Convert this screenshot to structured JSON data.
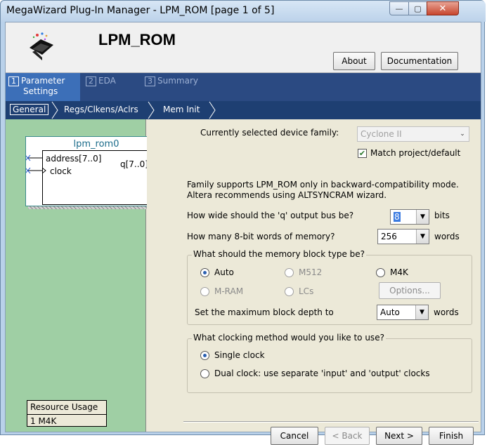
{
  "window": {
    "title": "MegaWizard Plug-In Manager - LPM_ROM [page 1 of 5]"
  },
  "header": {
    "heading": "LPM_ROM",
    "about_label": "About",
    "documentation_label": "Documentation"
  },
  "tabs": [
    {
      "num": "1",
      "line1": "Parameter",
      "line2": "Settings"
    },
    {
      "num": "2",
      "line1": "EDA",
      "line2": ""
    },
    {
      "num": "3",
      "line1": "Summary",
      "line2": ""
    }
  ],
  "breadcrumbs": [
    "General",
    "Regs/Clkens/Aclrs",
    "Mem Init"
  ],
  "symbol": {
    "name": "lpm_rom0",
    "in1": "address[7..0]",
    "in2": "clock",
    "out1": "q[7..0]"
  },
  "resource": {
    "title": "Resource Usage",
    "value": "1 M4K"
  },
  "form": {
    "device_family_label": "Currently selected device family:",
    "device_family_value": "Cyclone II",
    "match_label": "Match project/default",
    "note_line1": "Family supports LPM_ROM only in backward-compatibility mode.",
    "note_line2": "Altera recommends using ALTSYNCRAM wizard.",
    "q_width_label": "How wide should the 'q' output bus be?",
    "q_width_value": "8",
    "q_width_unit": "bits",
    "words_label": "How many 8-bit words of memory?",
    "words_value": "256",
    "words_unit": "words",
    "block_group_label": "What should the memory block type be?",
    "block_auto": "Auto",
    "block_m512": "M512",
    "block_m4k": "M4K",
    "block_mram": "M-RAM",
    "block_lcs": "LCs",
    "options_label": "Options...",
    "max_depth_label": "Set the maximum block depth to",
    "max_depth_value": "Auto",
    "max_depth_unit": "words",
    "clock_group_label": "What clocking method would you like to use?",
    "single_clock": "Single clock",
    "dual_clock": "Dual clock: use separate 'input' and 'output' clocks"
  },
  "footer": {
    "cancel": "Cancel",
    "back": "< Back",
    "next": "Next >",
    "finish": "Finish"
  }
}
